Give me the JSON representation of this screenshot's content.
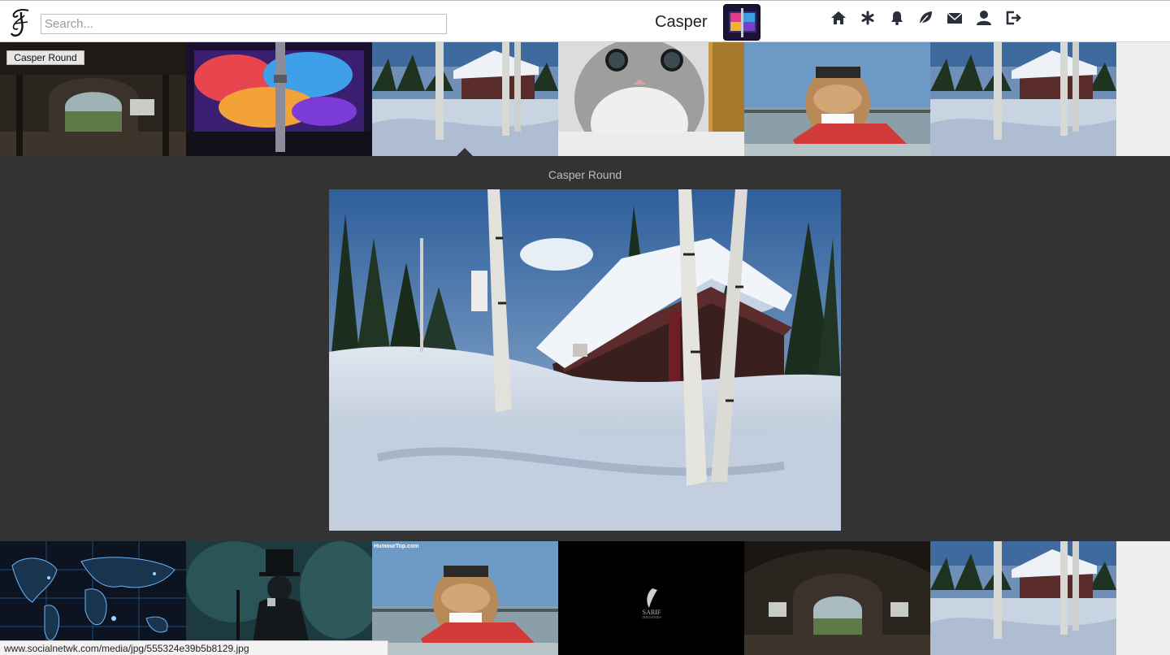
{
  "header": {
    "search_placeholder": "Search...",
    "username": "Casper",
    "nav_icons": [
      "home-icon",
      "asterisk-icon",
      "bell-icon",
      "leaf-icon",
      "envelope-icon",
      "user-icon",
      "logout-icon"
    ]
  },
  "top_row": {
    "hover_label": "Casper Round",
    "thumbs": [
      "abandoned-hall",
      "laptop-screen",
      "snowy-cabin",
      "kitten",
      "dog-on-jetski",
      "snowy-cabin"
    ]
  },
  "expanded": {
    "title": "Casper Round",
    "image": "snowy-cabin"
  },
  "bottom_row": {
    "thumbs": [
      "world-map",
      "top-hat-man",
      "dog-on-jetski",
      "sarif-logo",
      "abandoned-hall",
      "snowy-cabin"
    ],
    "watermark": "HumourTop.com",
    "logo_text": "SARIF",
    "logo_subtext": "INDUSTRIES"
  },
  "status_bar": {
    "url": "www.socialnetwk.com/media/jpg/555324e39b5b8129.jpg"
  }
}
